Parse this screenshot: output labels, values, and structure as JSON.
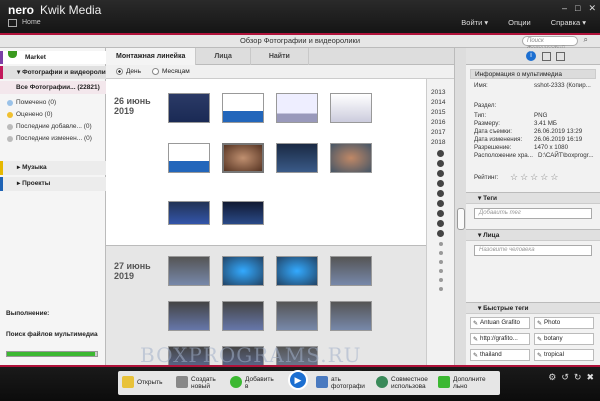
{
  "app": {
    "logo": "nero",
    "title": "Kwik Media",
    "home": "Home",
    "window_controls": [
      "‒",
      "□",
      "✕"
    ]
  },
  "menu": {
    "login": "Войти",
    "options": "Опции",
    "help": "Справка"
  },
  "subheader": {
    "title": "Обзор Фотографии и видеоролики",
    "search_placeholder": "Поиск Фотографий..."
  },
  "left": {
    "market": "Market",
    "photos": "Фотографии и видеороли",
    "all_photos": "Все Фотографии... (22821)",
    "items": [
      {
        "label": "Помечено (0)"
      },
      {
        "label": "Оценено (0)"
      },
      {
        "label": "Последние добавле... (0)"
      },
      {
        "label": "Последние изменен... (0)"
      }
    ],
    "music": "Музыка",
    "projects": "Проекты",
    "execution": "Выполнение:",
    "searching": "Поиск файлов мультимедиа",
    "progress": 0.98
  },
  "center": {
    "tabs": [
      "Монтажная линейка",
      "Лица",
      "Найти"
    ],
    "view": {
      "day": "День",
      "month": "Месяцам"
    },
    "groups": [
      {
        "date_line1": "26 июнь",
        "date_line2": "2019"
      },
      {
        "date_line1": "27 июнь",
        "date_line2": "2019"
      }
    ],
    "years": [
      "2013",
      "2014",
      "2015",
      "2016",
      "2017",
      "2018"
    ]
  },
  "right": {
    "media_info_title": "Информация о мультимедиа",
    "fields": [
      {
        "k": "Имя:",
        "v": "sshot-2333 (Копир..."
      },
      {
        "k": "Раздел:",
        "v": ""
      },
      {
        "k": "Тип:",
        "v": "PNG"
      },
      {
        "k": "Размеру:",
        "v": "3.41 МБ"
      },
      {
        "k": "Дата съемки:",
        "v": "26.06.2019 13:29"
      },
      {
        "k": "Дата изменения:",
        "v": "26.06.2019 16:19"
      },
      {
        "k": "Разрешение:",
        "v": "1470 x 1080"
      },
      {
        "k": "Расположение хра...",
        "v": "D:\\САЙТ\\boxprogr..."
      }
    ],
    "rating_label": "Рейтинг:",
    "tags_title": "Теги",
    "tags_placeholder": "Добавить тег",
    "faces_title": "Лица",
    "faces_placeholder": "Назовите человека",
    "quick_tags_title": "Быстрые теги",
    "quick_tags": [
      "Antuan Grafito",
      "Photo",
      "http://grafito...",
      "botany",
      "thailand",
      "tropical"
    ]
  },
  "actions": [
    {
      "label1": "Открыть",
      "label2": ""
    },
    {
      "label1": "Создать",
      "label2": "новый"
    },
    {
      "label1": "Добавить",
      "label2": "в"
    },
    {
      "label1": "ать",
      "label2": "фотографи"
    },
    {
      "label1": "Совместное",
      "label2": "использова"
    },
    {
      "label1": "Дополните",
      "label2": "льно"
    }
  ],
  "watermark": "BOXPROGRAMS.RU",
  "colors": {
    "accent": "#b0123a",
    "green": "#3cb832",
    "blue": "#1c6fd1"
  }
}
